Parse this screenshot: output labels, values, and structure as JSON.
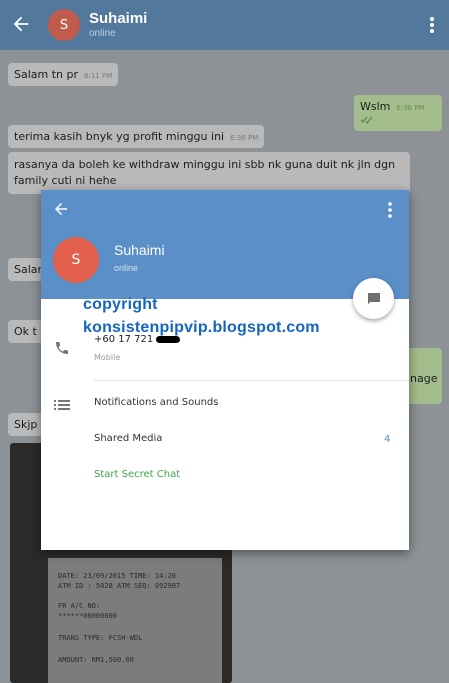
{
  "chat_header": {
    "avatar_letter": "S",
    "name": "Suhaimi",
    "status": "online"
  },
  "messages": [
    {
      "text": "Salam tn pr",
      "time": "6:11 PM",
      "dir": "in"
    },
    {
      "text": "Wslm",
      "time": "6:36 PM",
      "dir": "out"
    },
    {
      "text": "terima kasih bnyk yg profit minggu ini",
      "time": "6:36 PM",
      "dir": "in"
    },
    {
      "text": "rasanya da boleh ke withdraw minggu ini sbb nk guna duit nk jln dgn family cuti ni hehe",
      "time": "",
      "dir": "in"
    },
    {
      "text": "Salam",
      "time": "",
      "dir": "in"
    },
    {
      "text": "Ok t",
      "time": "",
      "dir": "in"
    },
    {
      "text": "Skjp",
      "time": "",
      "dir": "in"
    },
    {
      "text": "nage",
      "time": "",
      "dir": "out"
    }
  ],
  "receipt": {
    "lines": [
      "DATE: 23/09/2015   TIME: 14:20",
      "ATM ID : 5028    ATM SEQ: 092987",
      "FR A/C NO:",
      "******00000000",
      "TRANS TYPE:  FCSH-WDL",
      "AMOUNT:              RM1,500.00"
    ]
  },
  "profile": {
    "avatar_letter": "S",
    "name": "Suhaimi",
    "status": "online",
    "phone": "+60 17 721",
    "phone_label": "Mobile",
    "notifications_label": "Notifications and Sounds",
    "shared_media_label": "Shared Media",
    "shared_media_count": "4",
    "secret_chat_label": "Start Secret Chat"
  },
  "watermark": {
    "line1": "copyright",
    "line2": "konsistenpipvip.blogspot.com"
  },
  "colors": {
    "header": "#52789c",
    "modal_header": "#5b8fc7",
    "avatar": "#e25f4c",
    "secret_chat": "#3fa34d",
    "watermark": "#1565c0"
  },
  "icons": [
    "back-arrow-icon",
    "more-vert-icon",
    "chat-bubble-icon",
    "phone-icon",
    "list-icon",
    "double-check-icon"
  ]
}
